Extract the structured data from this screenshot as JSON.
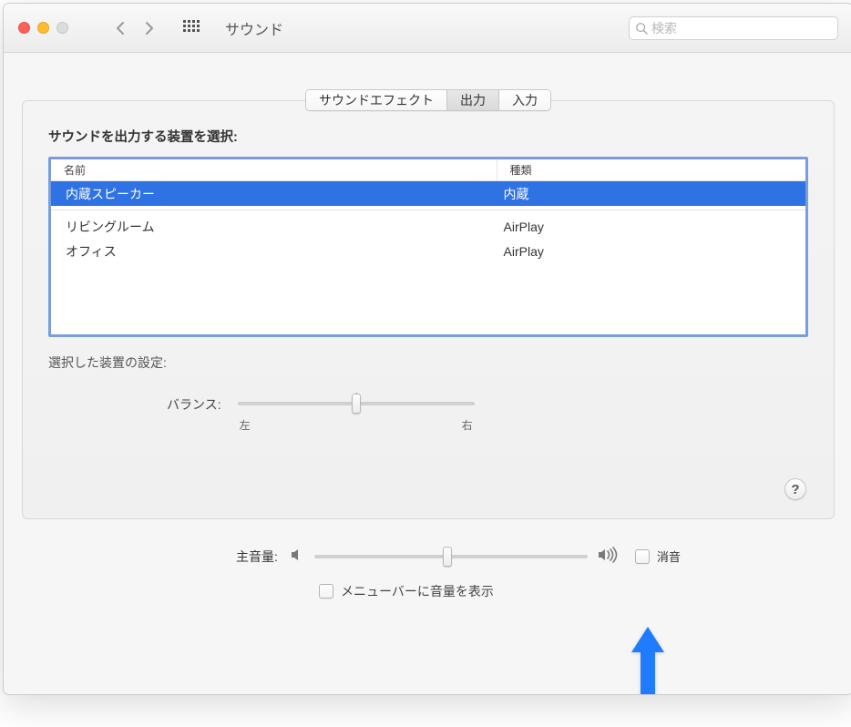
{
  "window": {
    "title": "サウンド",
    "search_placeholder": "検索"
  },
  "tabs": {
    "effects": "サウンドエフェクト",
    "output": "出力",
    "input": "入力",
    "active": "output"
  },
  "panel": {
    "select_device_label": "サウンドを出力する装置を選択:",
    "columns": {
      "name": "名前",
      "type": "種類"
    },
    "devices": [
      {
        "name": "内蔵スピーカー",
        "type": "内蔵",
        "selected": true
      },
      {
        "name": "リビングルーム",
        "type": "AirPlay",
        "selected": false
      },
      {
        "name": "オフィス",
        "type": "AirPlay",
        "selected": false
      }
    ],
    "selected_settings_label": "選択した装置の設定:",
    "balance": {
      "label": "バランス:",
      "left": "左",
      "right": "右",
      "value": 0.5
    }
  },
  "bottom": {
    "main_volume_label": "主音量:",
    "volume_value": 0.48,
    "mute_label": "消音",
    "mute_checked": false,
    "show_in_menubar_label": "メニューバーに音量を表示",
    "show_in_menubar_checked": false
  },
  "help_tooltip": "?"
}
